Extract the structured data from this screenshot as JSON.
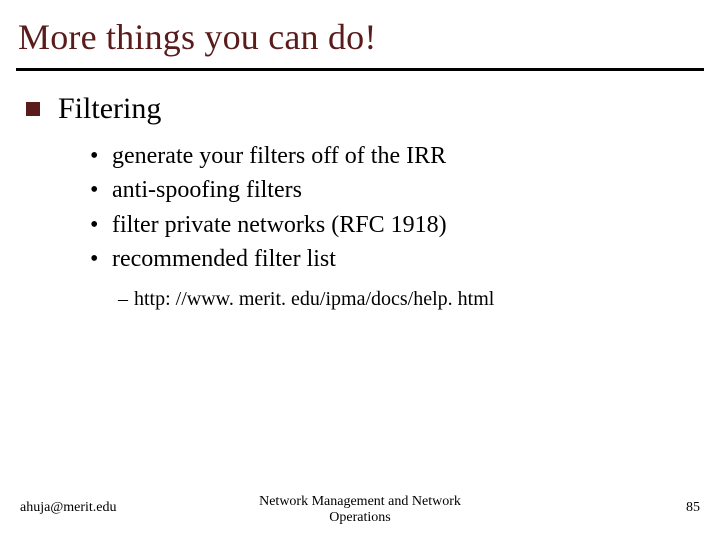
{
  "title": "More things you can do!",
  "body": {
    "heading": "Filtering",
    "items": [
      "generate your filters off of the IRR",
      "anti-spoofing filters",
      "filter private networks (RFC 1918)",
      "recommended filter list"
    ],
    "subitem": "http: //www. merit. edu/ipma/docs/help. html"
  },
  "footer": {
    "left": "ahuja@merit.edu",
    "center_line1": "Network Management and Network",
    "center_line2": "Operations",
    "page": "85"
  }
}
